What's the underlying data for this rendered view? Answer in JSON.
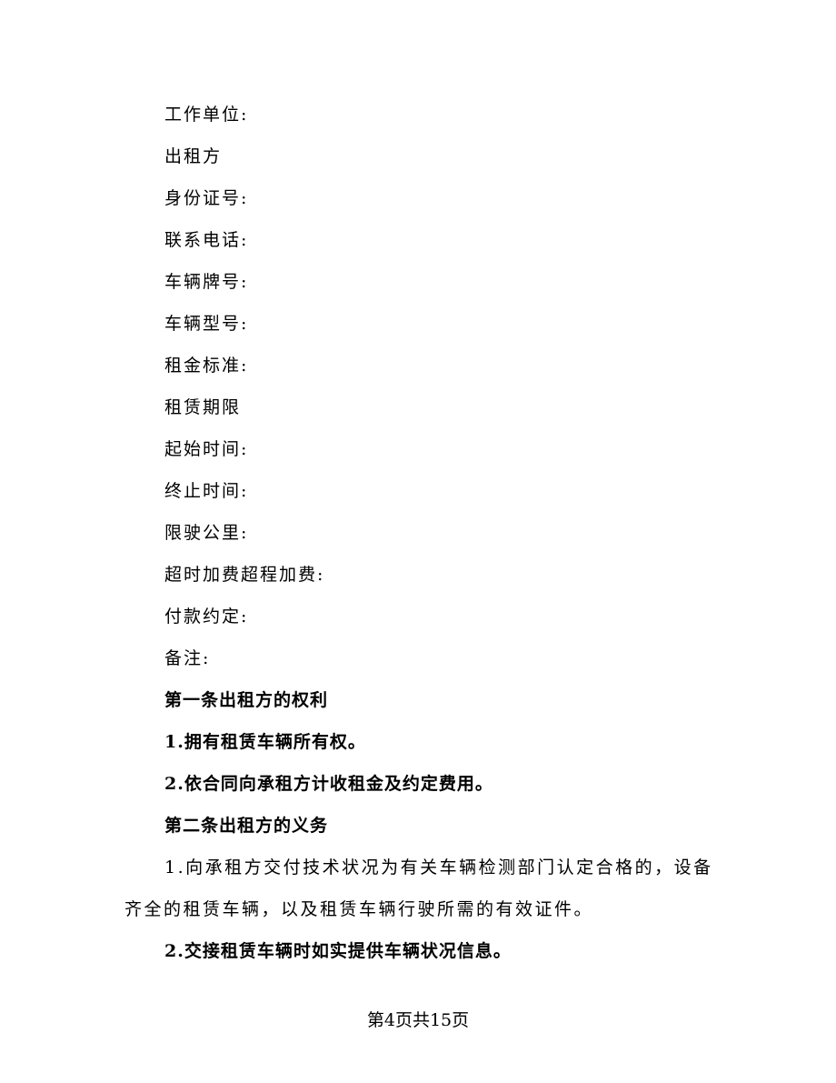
{
  "fields": [
    "工作单位:",
    "出租方",
    "身份证号:",
    "联系电话:",
    "车辆牌号:",
    "车辆型号:",
    "租金标准:",
    "租赁期限",
    "起始时间:",
    "终止时间:",
    "限驶公里:",
    "超时加费超程加费:",
    "付款约定:",
    "备注:"
  ],
  "section1": {
    "title": "第一条出租方的权利",
    "items": [
      "1.拥有租赁车辆所有权。",
      "2.依合同向承租方计收租金及约定费用。"
    ]
  },
  "section2": {
    "title": "第二条出租方的义务",
    "item1": "1.向承租方交付技术状况为有关车辆检测部门认定合格的，设备齐全的租赁车辆，以及租赁车辆行驶所需的有效证件。",
    "item2": "2.交接租赁车辆时如实提供车辆状况信息。"
  },
  "footer": {
    "page_label": "第4页共15页"
  }
}
